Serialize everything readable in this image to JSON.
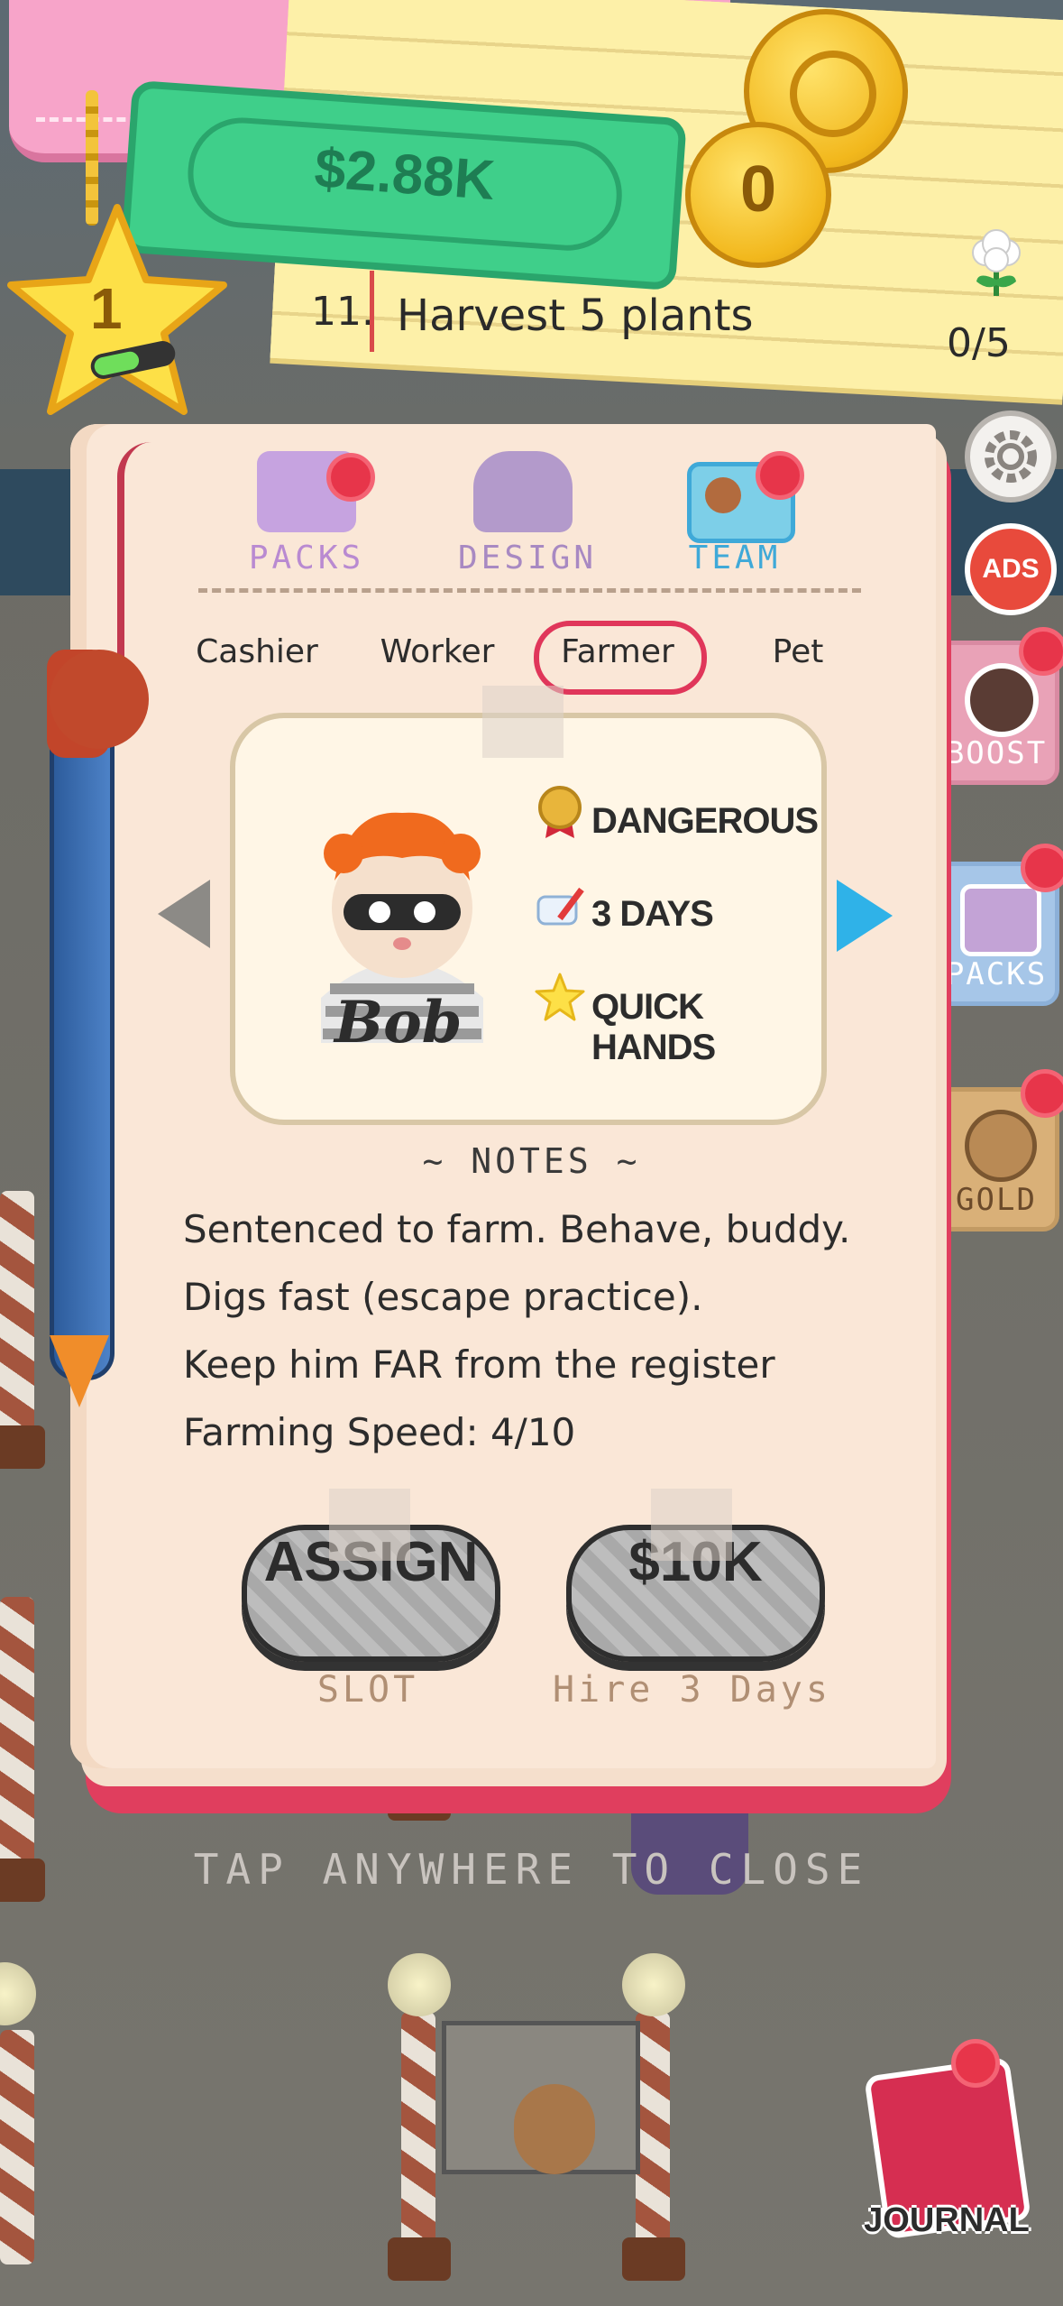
{
  "hud": {
    "money": "$2.88K",
    "coins": "0",
    "level": "1",
    "quest": {
      "number": "11.",
      "text": "Harvest 5 plants",
      "progress": "0/5"
    }
  },
  "side": {
    "ads_label": "ADS",
    "boost_label": "BOOST",
    "packs_label": "PACKS",
    "gold_label": "GOLD"
  },
  "journal": {
    "tabs": [
      {
        "label": "PACKS",
        "color": "#b98ad1"
      },
      {
        "label": "DESIGN",
        "color": "#a889c2"
      },
      {
        "label": "TEAM",
        "color": "#3fa9d8"
      }
    ],
    "categories": [
      "Cashier",
      "Worker",
      "Farmer",
      "Pet"
    ],
    "selected_category": "Farmer",
    "character": {
      "name": "Bob",
      "traits": [
        "DANGEROUS",
        "3 DAYS",
        "QUICK HANDS"
      ]
    },
    "notes_heading": "~ NOTES ~",
    "notes": [
      "Sentenced to farm. Behave, buddy.",
      "Digs fast (escape practice).",
      "Keep him FAR from the register",
      "Farming Speed: 4/10"
    ],
    "assign": {
      "label": "ASSIGN",
      "sub": "SLOT"
    },
    "hire": {
      "label": "$10K",
      "sub": "Hire 3 Days"
    }
  },
  "footer": {
    "tap_close": "TAP ANYWHERE TO CLOSE",
    "journal_label": "JOURNAL"
  },
  "colors": {
    "accent_red": "#e7354a",
    "team_blue": "#3fa9d8",
    "cover": "#e03e5e",
    "page": "#fae7d7"
  }
}
